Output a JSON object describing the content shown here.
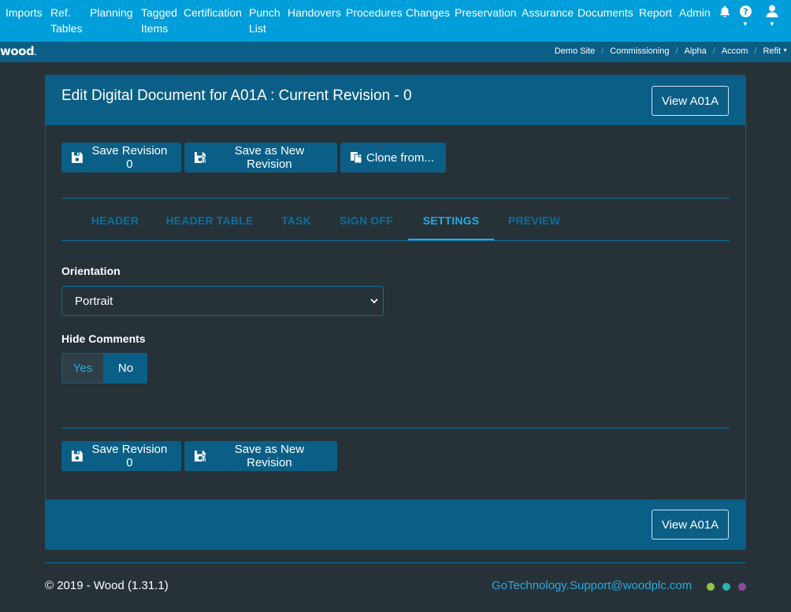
{
  "nav": {
    "items": [
      {
        "label": "Imports"
      },
      {
        "label": "Ref.\nTables"
      },
      {
        "label": "Planning"
      },
      {
        "label": "Tagged\nItems"
      },
      {
        "label": "Certification"
      },
      {
        "label": "Punch\nList"
      },
      {
        "label": "Handovers"
      },
      {
        "label": "Procedures"
      },
      {
        "label": "Changes"
      },
      {
        "label": "Preservation"
      },
      {
        "label": "Assurance"
      },
      {
        "label": "Documents"
      },
      {
        "label": "Report"
      },
      {
        "label": "Admin"
      }
    ],
    "icons": [
      "bell-icon",
      "help-icon",
      "user-icon"
    ]
  },
  "subbar": {
    "logo": "wood",
    "breadcrumb": [
      "Demo Site",
      "Commissioning",
      "Alpha",
      "Accom",
      "Refit"
    ]
  },
  "card": {
    "title": "Edit Digital Document for A01A : Current Revision - 0",
    "view_button": "View A01A",
    "actions": {
      "save_revision": "Save Revision 0",
      "save_new_revision": "Save as New Revision",
      "clone_from": "Clone from..."
    },
    "tabs": [
      {
        "label": "HEADER",
        "active": false
      },
      {
        "label": "HEADER TABLE",
        "active": false
      },
      {
        "label": "TASK",
        "active": false
      },
      {
        "label": "SIGN OFF",
        "active": false
      },
      {
        "label": "SETTINGS",
        "active": true
      },
      {
        "label": "PREVIEW",
        "active": false
      }
    ],
    "settings": {
      "orientation_label": "Orientation",
      "orientation_value": "Portrait",
      "hide_comments_label": "Hide Comments",
      "hide_comments_yes": "Yes",
      "hide_comments_no": "No",
      "hide_comments_selected": "No"
    }
  },
  "footer": {
    "copyright": "© 2019 - Wood (1.31.1)",
    "support_email": "GoTechnology.Support@woodplc.com",
    "dot_colors": [
      "#8dc63f",
      "#26b6b3",
      "#8e4a9f"
    ]
  },
  "colors": {
    "nav_bg": "#009edb",
    "subbar_bg": "#0b5f87",
    "page_bg": "#263238",
    "accent": "#2ba8e0"
  }
}
